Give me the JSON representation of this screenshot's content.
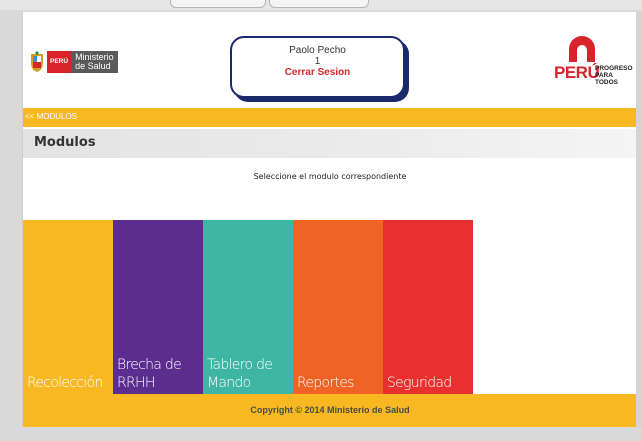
{
  "header": {
    "minsa_country": "PERÚ",
    "minsa_name_line1": "Ministerio",
    "minsa_name_line2": "de Salud",
    "user_name": "Paolo Pecho",
    "user_id": "1",
    "logout_label": "Cerrar Sesion",
    "peru_logo_word": "PERÚ",
    "peru_logo_tag_line1": "PROGRESO",
    "peru_logo_tag_line2": "PARA TODOS"
  },
  "breadcrumb": "<< MODULOS",
  "page_title": "Modulos",
  "instruction": "Seleccione el modulo correspondiente",
  "modules": [
    {
      "line1": "Recolección",
      "line2": "",
      "color": "#f7b822"
    },
    {
      "line1": "Brecha de",
      "line2": "RRHH",
      "color": "#5b2d8e"
    },
    {
      "line1": "Tablero de",
      "line2": "Mando",
      "color": "#3fb5a3"
    },
    {
      "line1": "Reportes",
      "line2": "",
      "color": "#ef6425"
    },
    {
      "line1": "Seguridad",
      "line2": "",
      "color": "#e8312e"
    }
  ],
  "footer": "Copyright © 2014 Ministerio de Salud",
  "colors": {
    "accent_yellow": "#f7b822",
    "brand_red": "#d8232a",
    "box_border": "#1a2a6c"
  }
}
